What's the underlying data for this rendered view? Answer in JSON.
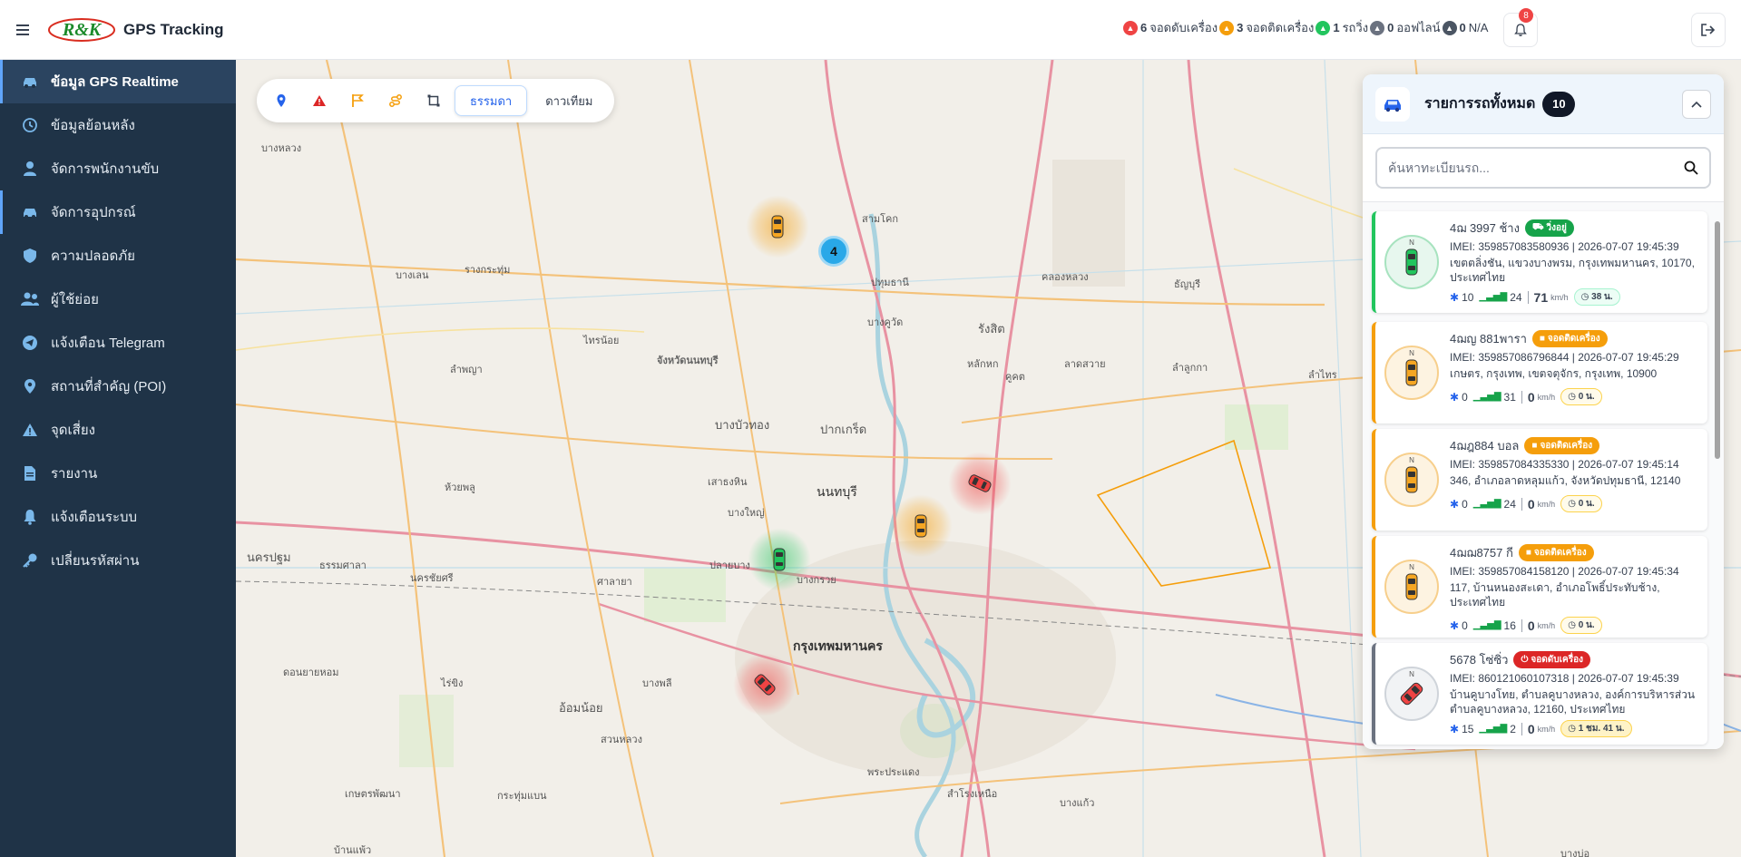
{
  "app": {
    "title": "GPS Tracking",
    "logo_text": "R&K"
  },
  "status_summary": [
    {
      "count": "6",
      "label": "จอดดับเครื่อง",
      "color": "#ef4444",
      "icon": "car-icon"
    },
    {
      "count": "3",
      "label": "จอดติดเครื่อง",
      "color": "#f59e0b",
      "icon": "car-icon"
    },
    {
      "count": "1",
      "label": "รถวิ่ง",
      "color": "#22c55e",
      "icon": "car-icon"
    },
    {
      "count": "0",
      "label": "ออฟไลน์",
      "color": "#6b7280",
      "icon": "car-icon"
    },
    {
      "count": "0",
      "label": "N/A",
      "color": "#4b5563",
      "icon": "car-icon"
    }
  ],
  "notifications": {
    "count": "8"
  },
  "sidebar": {
    "items": [
      {
        "label": "ข้อมูล GPS Realtime",
        "icon": "car-icon"
      },
      {
        "label": "ข้อมูลย้อนหลัง",
        "icon": "history-icon"
      },
      {
        "label": "จัดการพนักงานขับ",
        "icon": "user-icon"
      },
      {
        "label": "จัดการอุปกรณ์",
        "icon": "car-icon"
      },
      {
        "label": "ความปลอดภัย",
        "icon": "shield-icon"
      },
      {
        "label": "ผู้ใช้ย่อย",
        "icon": "users-icon"
      },
      {
        "label": "แจ้งเตือน Telegram",
        "icon": "telegram-icon"
      },
      {
        "label": "สถานที่สำคัญ (POI)",
        "icon": "map-pin-icon"
      },
      {
        "label": "จุดเสี่ยง",
        "icon": "warning-icon"
      },
      {
        "label": "รายงาน",
        "icon": "document-icon"
      },
      {
        "label": "แจ้งเตือนระบบ",
        "icon": "bell-icon"
      },
      {
        "label": "เปลี่ยนรหัสผ่าน",
        "icon": "key-icon"
      }
    ]
  },
  "map": {
    "modes": [
      "ธรรมดา",
      "ดาวเทียม"
    ],
    "active_mode": "ธรรมดา",
    "tools": [
      "map-pin-icon",
      "warning-icon",
      "flag-icon",
      "route-icon",
      "area-icon"
    ],
    "cluster_count": "4",
    "labels": [
      "บางหลวง",
      "บางเลน",
      "รางกระทุ่ม",
      "ไทรน้อย",
      "จังหวัดนนทบุรี",
      "ลำพญา",
      "บางบัวทอง",
      "ปากเกร็ด",
      "ห้วยพลู",
      "นนทบุรี",
      "บางใหญ่",
      "เสาธงหิน",
      "นครปฐม",
      "ธรรมศาลา",
      "นครชัยศรี",
      "ศาลายา",
      "ปลายบาง",
      "บางกรวย",
      "กรุงเทพมหานคร",
      "อ้อมน้อย",
      "ดอนยายหอม",
      "ไร่ขิง",
      "บางพลี",
      "สวนหลวง",
      "พระประแดง",
      "คลองหลวง",
      "ธัญบุรี",
      "รังสิต",
      "ลำลูกกา",
      "ลาดสวาย",
      "คูคต",
      "สามโคก",
      "ปทุมธานี",
      "บางคูวัด",
      "หลักหก",
      "ลำไทร",
      "เกษตรพัฒนา",
      "บ้านแพ้ว",
      "กระทุ่มแบน",
      "สำโรงเหนือ",
      "บางแก้ว",
      "บางบ่อ"
    ]
  },
  "vehicle_panel": {
    "title": "รายการรถทั้งหมด",
    "count": "10",
    "search_placeholder": "ค้นหาทะเบียนรถ...",
    "vehicles": [
      {
        "plate": "4ฌ 3997 ช้าง",
        "status": "วิ่งอยู่",
        "status_color": "green",
        "imei": "IMEI: 359857083580936 | 2026-07-07 19:45:39",
        "address": "เขตตลิ่งชัน, แขวงบางพรม, กรุงเทพมหานคร, 10170, ประเทศไทย",
        "satellites": "10",
        "signal": "24",
        "speed": "71",
        "speed_unit": "km/h",
        "duration": "38 น."
      },
      {
        "plate": "4ฌญ 881พารา",
        "status": "จอดติดเครื่อง",
        "status_color": "yellow",
        "imei": "IMEI: 359857086796844 | 2026-07-07 19:45:29",
        "address": "เกษตร, กรุงเทพ, เขตจตุจักร, กรุงเทพ, 10900",
        "satellites": "0",
        "signal": "31",
        "speed": "0",
        "speed_unit": "km/h",
        "duration": "0 น."
      },
      {
        "plate": "4ฌฎ884 บอล",
        "status": "จอดติดเครื่อง",
        "status_color": "yellow",
        "imei": "IMEI: 359857084335330 | 2026-07-07 19:45:14",
        "address": "346, อำเภอลาดหลุมแก้ว, จังหวัดปทุมธานี, 12140",
        "satellites": "0",
        "signal": "24",
        "speed": "0",
        "speed_unit": "km/h",
        "duration": "0 น."
      },
      {
        "plate": "4ฌฌ8757 กี",
        "status": "จอดติดเครื่อง",
        "status_color": "yellow",
        "imei": "IMEI: 359857084158120 | 2026-07-07 19:45:34",
        "address": "117, บ้านหนองสะเดา, อำเภอโพธิ์ประทับช้าง, ประเทศไทย",
        "satellites": "0",
        "signal": "16",
        "speed": "0",
        "speed_unit": "km/h",
        "duration": "0 น."
      },
      {
        "plate": "5678 โซ่ซิ่ว",
        "status": "จอดดับเครื่อง",
        "status_color": "red",
        "imei": "IMEI: 860121060107318 | 2026-07-07 19:45:39",
        "address": "บ้านคูบางโทย, ตำบลคูบางหลวง, องค์การบริหารส่วนตำบลคูบางหลวง, 12160, ประเทศไทย",
        "satellites": "15",
        "signal": "2",
        "speed": "0",
        "speed_unit": "km/h",
        "duration": "1 ชม. 41 น."
      }
    ]
  }
}
